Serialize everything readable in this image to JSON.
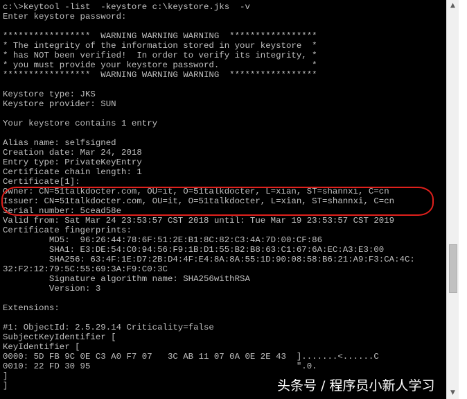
{
  "console": {
    "lines": [
      "c:\\>keytool -list  -keystore c:\\keystore.jks  -v",
      "Enter keystore password:",
      "",
      "*****************  WARNING WARNING WARNING  *****************",
      "* The integrity of the information stored in your keystore  *",
      "* has NOT been verified!  In order to verify its integrity, *",
      "* you must provide your keystore password.                  *",
      "*****************  WARNING WARNING WARNING  *****************",
      "",
      "Keystore type: JKS",
      "Keystore provider: SUN",
      "",
      "Your keystore contains 1 entry",
      "",
      "Alias name: selfsigned",
      "Creation date: Mar 24, 2018",
      "Entry type: PrivateKeyEntry",
      "Certificate chain length: 1",
      "Certificate[1]:",
      "Owner: CN=51talkdocter.com, OU=it, O=51talkdocter, L=xian, ST=shannxi, C=cn",
      "Issuer: CN=51talkdocter.com, OU=it, O=51talkdocter, L=xian, ST=shannxi, C=cn",
      "Serial number: 5cead58e",
      "Valid from: Sat Mar 24 23:53:57 CST 2018 until: Tue Mar 19 23:53:57 CST 2019",
      "Certificate fingerprints:",
      "         MD5:  96:26:44:78:6F:51:2E:B1:8C:82:C3:4A:7D:00:CF:86",
      "         SHA1: E3:DE:54:C0:94:56:F9:1B:D1:55:B2:B8:63:C1:67:6A:EC:A3:E3:00",
      "         SHA256: 63:4F:1E:D7:2B:D4:4F:E4:8A:8A:55:1D:90:08:58:B6:21:A9:F3:CA:4C:",
      "32:F2:12:79:5C:55:69:3A:F9:C0:3C",
      "         Signature algorithm name: SHA256withRSA",
      "         Version: 3",
      "",
      "Extensions:",
      "",
      "#1: ObjectId: 2.5.29.14 Criticality=false",
      "SubjectKeyIdentifier [",
      "KeyIdentifier [",
      "0000: 5D FB 9C 0E C3 A0 F7 07   3C AB 11 07 0A 0E 2E 43  ].......<......C",
      "0010: 22 FD 30 95                                        \".0.",
      "]",
      "]"
    ]
  },
  "watermark": "头条号 / 程序员小新人学习",
  "colors": {
    "background": "#000000",
    "text": "#c0c0c0",
    "highlight": "#e0201c"
  },
  "icons": {
    "scroll_up": "arrow-up-icon",
    "scroll_down": "arrow-down-icon"
  }
}
